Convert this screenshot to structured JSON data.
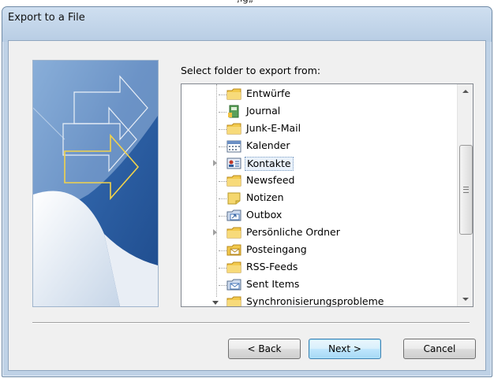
{
  "window": {
    "title": "Export to a File"
  },
  "dialog": {
    "prompt": "Select folder to export from:"
  },
  "tree": {
    "items": [
      {
        "label": "Entwürfe",
        "icon": "folder-icon",
        "expander": "none"
      },
      {
        "label": "Journal",
        "icon": "journal-icon",
        "expander": "none"
      },
      {
        "label": "Junk-E-Mail",
        "icon": "folder-icon",
        "expander": "none"
      },
      {
        "label": "Kalender",
        "icon": "calendar-icon",
        "expander": "none"
      },
      {
        "label": "Kontakte",
        "icon": "contacts-icon",
        "expander": "collapsed",
        "selected": true
      },
      {
        "label": "Newsfeed",
        "icon": "folder-icon",
        "expander": "none"
      },
      {
        "label": "Notizen",
        "icon": "notes-icon",
        "expander": "none"
      },
      {
        "label": "Outbox",
        "icon": "outbox-icon",
        "expander": "none"
      },
      {
        "label": "Persönliche Ordner",
        "icon": "folder-icon",
        "expander": "collapsed"
      },
      {
        "label": "Posteingang",
        "icon": "inbox-icon",
        "expander": "none"
      },
      {
        "label": "RSS-Feeds",
        "icon": "folder-icon",
        "expander": "none"
      },
      {
        "label": "Sent Items",
        "icon": "sent-items-icon",
        "expander": "none"
      },
      {
        "label": "Synchronisierungsprobleme",
        "icon": "folder-icon",
        "expander": "expanded"
      }
    ],
    "scroll_position": 0.45
  },
  "buttons": {
    "back": "< Back",
    "next": "Next >",
    "cancel": "Cancel"
  },
  "colors": {
    "dialog_frame": "#bfd2e6",
    "client_background": "#f0f0f0",
    "default_button": "#3c7fb1",
    "folder": "#f2c94c"
  }
}
